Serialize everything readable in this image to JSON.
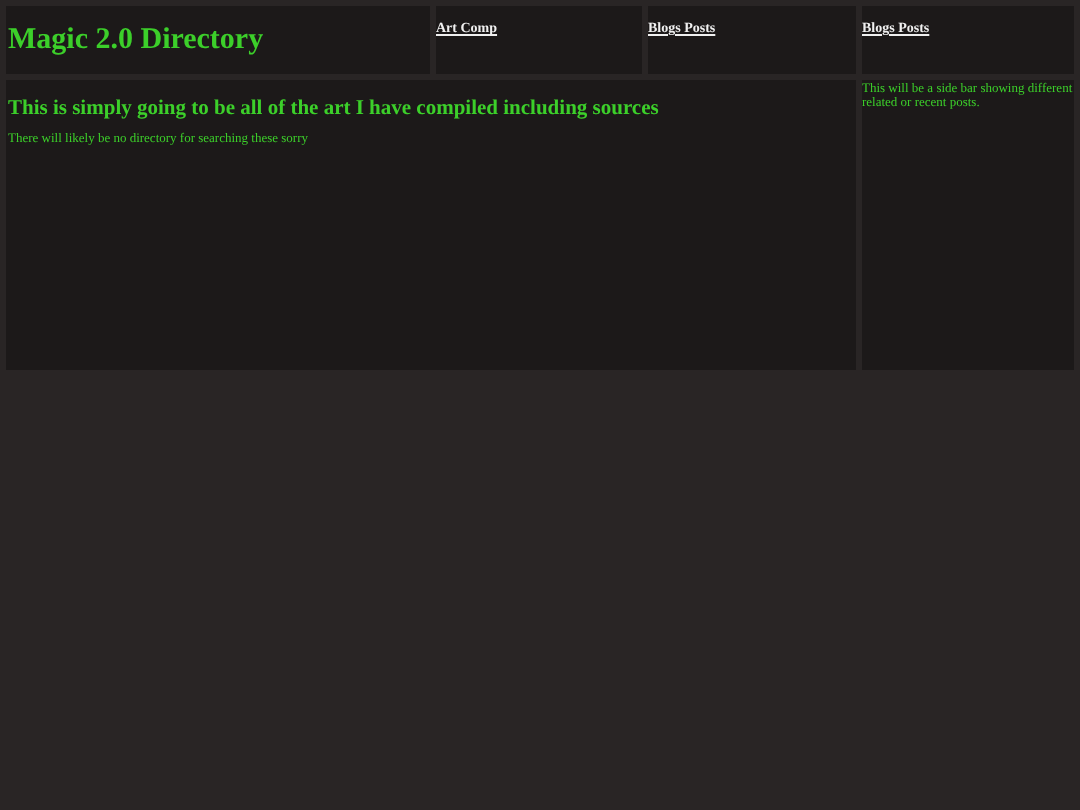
{
  "site_title": "Magic 2.0 Directory",
  "nav_links": [
    {
      "label": "Art Comp"
    },
    {
      "label": "Blogs Posts"
    },
    {
      "label": "Blogs Posts"
    }
  ],
  "main": {
    "heading": "This is simply going to be all of the art I have compiled including sources",
    "text": "There will likely be no directory for searching these sorry"
  },
  "sidebar": {
    "text": "This will be a side bar showing different related or recent posts."
  }
}
